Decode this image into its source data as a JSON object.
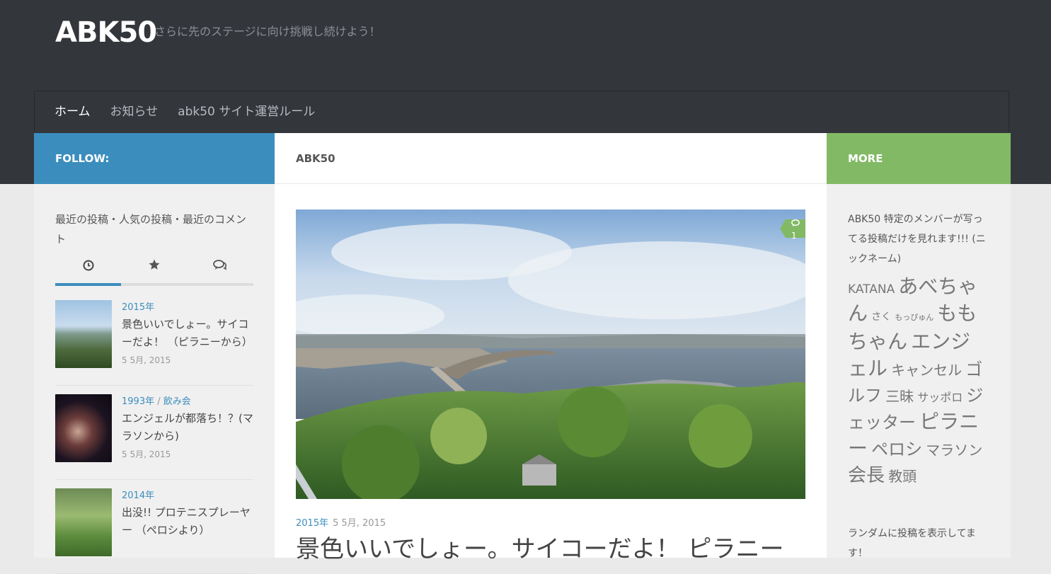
{
  "header": {
    "site_title": "ABK50",
    "tagline": "さらに先のステージに向け挑戦し続けよう！"
  },
  "nav": {
    "items": [
      "ホーム",
      "お知らせ",
      "abk50 サイト運営ルール"
    ]
  },
  "left": {
    "bar_label": "FOLLOW:",
    "widget_title": "最近の投稿・人気の投稿・最近のコメント",
    "tabs": [
      "clock-icon",
      "star-icon",
      "comments-icon"
    ],
    "posts": [
      {
        "category": "2015年",
        "category2": "",
        "title": "景色いいでしょー。サイコーだよ！ （ピラニーから）",
        "date": "5 5月, 2015"
      },
      {
        "category": "1993年",
        "category2": "飲み会",
        "title": "エンジェルが都落ち！？(マラソンから)",
        "date": "5 5月, 2015"
      },
      {
        "category": "2014年",
        "category2": "",
        "title": "出没!! プロテニスプレーヤー （ペロシより）",
        "date": ""
      }
    ]
  },
  "main": {
    "bar_label": "ABK50",
    "comment_count": "1",
    "meta_category": "2015年",
    "meta_date": "5 5月, 2015",
    "post_title": "景色いいでしょー。サイコーだよ！ ピラニー"
  },
  "right": {
    "bar_label": "MORE",
    "widget_text": "ABK50 特定のメンバーが写ってる投稿だけを見れます!!! (ニックネーム)",
    "tags": [
      {
        "label": "KATANA",
        "size": 17
      },
      {
        "label": "あべちゃん",
        "size": 28
      },
      {
        "label": "さく",
        "size": 14
      },
      {
        "label": "もっぴゅん",
        "size": 11
      },
      {
        "label": "ももちゃん",
        "size": 28
      },
      {
        "label": "エンジェル",
        "size": 28
      },
      {
        "label": "キャンセル",
        "size": 20
      },
      {
        "label": "ゴルフ",
        "size": 24
      },
      {
        "label": "三昧",
        "size": 20
      },
      {
        "label": "サッポロ",
        "size": 16
      },
      {
        "label": "ジェッター",
        "size": 24
      },
      {
        "label": "ピラニー",
        "size": 28
      },
      {
        "label": "ペロシ",
        "size": 24
      },
      {
        "label": "マラソン",
        "size": 20
      },
      {
        "label": "会長",
        "size": 26
      },
      {
        "label": "教頭",
        "size": 20
      }
    ],
    "widget2_text": "ランダムに投稿を表示してます！"
  },
  "colors": {
    "header_bg": "#33363b",
    "follow_blue": "#3b8dbd",
    "more_green": "#82b965"
  }
}
